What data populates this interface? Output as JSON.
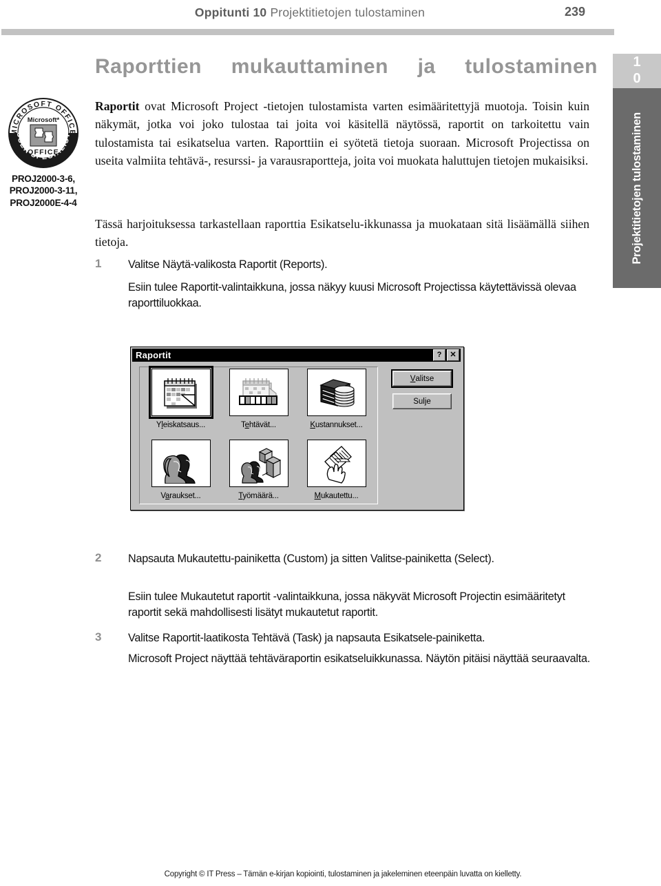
{
  "header": {
    "lesson_label": "Oppitunti 10",
    "title": "Projektitietojen tulostaminen",
    "page_number": "239"
  },
  "side_tab": {
    "number": "10",
    "label": "Projektitietojen tulostaminen"
  },
  "section": {
    "title": "Raporttien mukauttaminen ja tulostaminen"
  },
  "mous": {
    "top_arc": "MICROSOFT OFFICE",
    "bottom_arc": "USER SPECIALIST",
    "brand": "Microsoft",
    "office": "OFFICE",
    "codes": "PROJ2000-3-6, PROJ2000-3-11, PROJ2000E-4-4"
  },
  "body": {
    "para1_lead": "Raportit",
    "para1": " ovat Microsoft Project -tietojen tulostamista varten esimääritettyjä muotoja. Toisin kuin näkymät, jotka voi joko tulostaa tai joita voi käsitellä näytössä, raportit on tarkoitettu vain tulostamista tai esikatselua varten. Raporttiin ei syötetä tietoja suoraan. Microsoft Projectissa on useita valmiita tehtävä-, resurssi- ja varausraportteja, joita voi muokata haluttujen tietojen mukaisiksi.",
    "para2": "Tässä harjoituksessa tarkastellaan raporttia Esikatselu-ikkunassa ja muokataan sitä lisäämällä siihen tietoja."
  },
  "steps": [
    {
      "number": "1",
      "text": "Valitse Näytä-valikosta Raportit (Reports).",
      "sub": "Esiin tulee Raportit-valintaikkuna, jossa näkyy kuusi Microsoft Projectissa käytettävissä olevaa raporttiluokkaa."
    },
    {
      "number": "2",
      "text": "Napsauta Mukautettu-painiketta (Custom) ja sitten Valitse-painiketta (Select).",
      "sub": "Esiin tulee Mukautetut raportit -valintaikkuna, jossa näkyvät Microsoft Projectin esimääritetyt raportit sekä mahdollisesti lisätyt mukautetut raportit."
    },
    {
      "number": "3",
      "text": "Valitse Raportit-laatikosta Tehtävä (Task) ja napsauta Esikatsele-painiketta.",
      "sub": "Microsoft Project näyttää tehtäväraportin esikatseluikkunassa. Näytön pitäisi näyttää seuraavalta."
    }
  ],
  "dialog": {
    "title": "Raportit",
    "help_button": "?",
    "close_button": "✕",
    "icons": [
      {
        "label_pre": "Y",
        "label_key": "l",
        "label_post": "eiskatsaus...",
        "label": "Yleiskatsaus...",
        "icon": "calendar-icon",
        "selected": true
      },
      {
        "label_pre": "T",
        "label_key": "e",
        "label_post": "htävät...",
        "label": "Tehtävät...",
        "icon": "calendar-filmstrip-icon",
        "selected": false
      },
      {
        "label_pre": "",
        "label_key": "K",
        "label_post": "ustannukset...",
        "label": "Kustannukset...",
        "icon": "coins-stack-icon",
        "selected": false
      },
      {
        "label_pre": "V",
        "label_key": "a",
        "label_post": "raukset...",
        "label": "Varaukset...",
        "icon": "two-people-icon",
        "selected": false
      },
      {
        "label_pre": "",
        "label_key": "T",
        "label_post": "yömäärä...",
        "label": "Työmäärä...",
        "icon": "people-bars-icon",
        "selected": false
      },
      {
        "label_pre": "",
        "label_key": "M",
        "label_post": "ukautettu...",
        "label": "Mukautettu...",
        "icon": "hand-documents-icon",
        "selected": false
      }
    ],
    "buttons": {
      "select_pre": "",
      "select_key": "V",
      "select_post": "alitse",
      "select": "Valitse",
      "close_pre": "Sul",
      "close_key": "j",
      "close_post": "e",
      "close": "Sulje"
    }
  },
  "footer": {
    "text": "Copyright © IT Press – Tämän e-kirjan kopiointi, tulostaminen ja jakeleminen eteenpäin luvatta on kielletty."
  },
  "colors": {
    "rule": "#c2c2c2",
    "section_title": "#969696",
    "tab_number_bg": "#c8c8c8",
    "tab_body_bg": "#6b6b6b",
    "step_number": "#8e8e8e",
    "dialog_face": "#c0c0c0"
  }
}
